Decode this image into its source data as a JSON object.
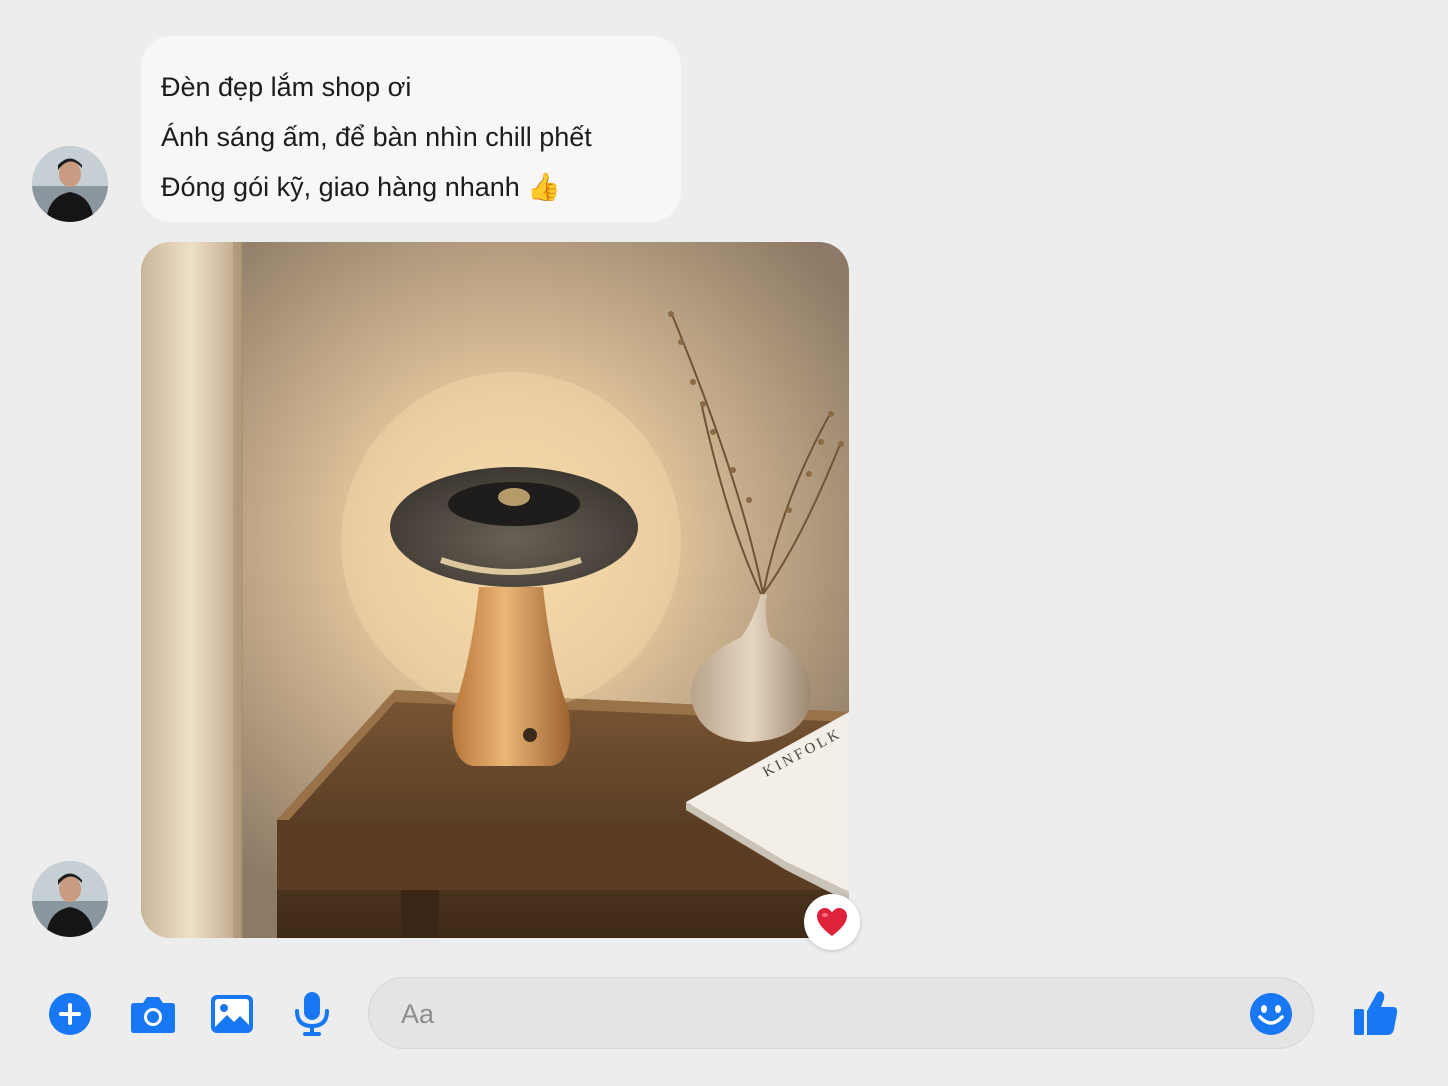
{
  "conversation": {
    "messages": [
      {
        "type": "text",
        "lines": [
          "Đèn đẹp lắm shop ơi",
          "Ánh sáng ấm, để bàn nhìn chill phết",
          "Đóng gói kỹ, giao hàng nhanh 👍"
        ]
      },
      {
        "type": "image",
        "image_icon": "photo-lamp-on-wooden-table",
        "reaction": "❤️"
      }
    ]
  },
  "composer": {
    "placeholder": "Aa",
    "buttons": [
      "plus-icon",
      "camera-icon",
      "gallery-icon",
      "microphone-icon"
    ],
    "emoji_icon": "smile-icon",
    "send_icon": "thumbs-up-icon"
  },
  "colors": {
    "accent": "#1877f2",
    "background": "#ededed",
    "bubble": "#f7f7f7",
    "reaction": "#e0213a"
  }
}
